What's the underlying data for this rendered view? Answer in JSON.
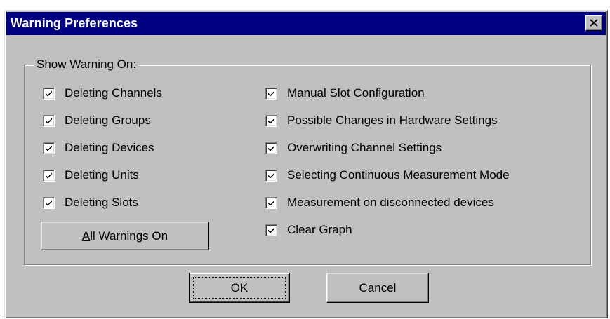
{
  "window": {
    "title": "Warning Preferences",
    "close_icon": "close-x-icon"
  },
  "group": {
    "label": "Show Warning On:"
  },
  "left_options": [
    {
      "label": "Deleting Channels",
      "checked": true
    },
    {
      "label": "Deleting Groups",
      "checked": true
    },
    {
      "label": "Deleting Devices",
      "checked": true
    },
    {
      "label": "Deleting Units",
      "checked": true
    },
    {
      "label": "Deleting Slots",
      "checked": true
    }
  ],
  "right_options": [
    {
      "label": "Manual Slot Configuration",
      "checked": true
    },
    {
      "label": "Possible Changes in Hardware Settings",
      "checked": true
    },
    {
      "label": "Overwriting Channel Settings",
      "checked": true
    },
    {
      "label": "Selecting Continuous Measurement Mode",
      "checked": true
    },
    {
      "label": "Measurement on disconnected devices",
      "checked": true
    },
    {
      "label": "Clear Graph",
      "checked": true
    }
  ],
  "buttons": {
    "all_warnings_accel": "A",
    "all_warnings_rest": "ll Warnings On",
    "ok": "OK",
    "cancel": "Cancel"
  },
  "colors": {
    "titlebar": "#000080",
    "face": "#c0c0c0"
  }
}
